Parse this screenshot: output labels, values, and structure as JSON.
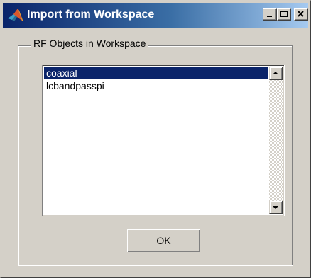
{
  "window": {
    "title": "Import from Workspace",
    "icon": "matlab-logo-icon",
    "controls": [
      "minimize-icon",
      "maximize-icon",
      "close-icon"
    ]
  },
  "group": {
    "label": "RF Objects in Workspace"
  },
  "listbox": {
    "items": [
      {
        "label": "coaxial",
        "selected": true
      },
      {
        "label": "lcbandpasspi",
        "selected": false
      }
    ]
  },
  "buttons": {
    "ok_label": "OK"
  },
  "colors": {
    "dialog_background": "#d4d0c8",
    "titlebar_start": "#0a246a",
    "titlebar_end": "#a6caf0",
    "selection": "#0a246a"
  }
}
